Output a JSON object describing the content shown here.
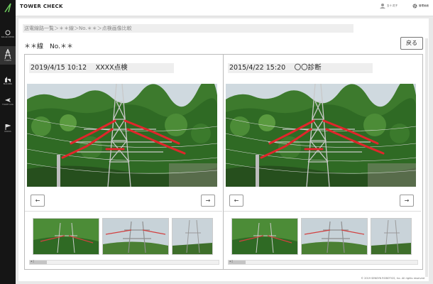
{
  "app": {
    "title": "TOWER CHECK"
  },
  "sidebar": {
    "items": [
      {
        "icon": "solar-icon",
        "label": "SOLAR\nCHECK"
      },
      {
        "icon": "tower-icon",
        "label": "TOWER"
      },
      {
        "icon": "building-icon",
        "label": "BUILDING"
      },
      {
        "icon": "plane-icon",
        "label": "FLIGHT\nLOG"
      },
      {
        "icon": "flag-icon",
        "label": "DOCKS"
      }
    ]
  },
  "header": {
    "user_label": "五十 花子",
    "settings_label": "管理画面"
  },
  "breadcrumb": "送電線路一覧＞＊＊線＞No.＊＊＞点検画像比較",
  "page": {
    "line_title": "＊＊線　No.＊＊",
    "back_label": "戻る"
  },
  "panels": [
    {
      "title": "2019/4/15 10:12　 XXXX点検",
      "prev_label": "←",
      "next_label": "→",
      "scroll_label": "◂ ▯"
    },
    {
      "title": "2015/4/22 15:20　 〇〇診断",
      "prev_label": "←",
      "next_label": "→",
      "scroll_label": "◂ ▯"
    }
  ],
  "footer": {
    "copyright": "© 2019 SENSYN ROBOTICS, Inc. All rights reserved"
  },
  "colors": {
    "sidebar_bg": "#151515",
    "highlight": "#e0262b",
    "sky": "#cfd9df",
    "trees": "#3d7a2d"
  }
}
